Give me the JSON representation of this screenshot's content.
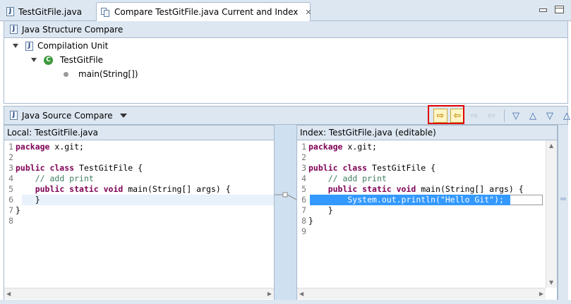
{
  "tabs": [
    {
      "label": "TestGitFile.java",
      "icon": "java-file-icon",
      "active": false
    },
    {
      "label": "Compare TestGitFile.java Current and Index",
      "icon": "compare-icon",
      "active": true,
      "close": "✕"
    }
  ],
  "structure": {
    "title": "Java Structure Compare",
    "tree": [
      {
        "label": "Compilation Unit",
        "icon": "java-file-icon",
        "expanded": true
      },
      {
        "label": "TestGitFile",
        "icon": "class-icon",
        "expanded": true
      },
      {
        "label": "main(String[])",
        "icon": "method-icon"
      }
    ]
  },
  "source_compare": {
    "title": "Java Source Compare",
    "toolbar": [
      {
        "icon": "copy-left-to-right-icon",
        "glyph": "⇨"
      },
      {
        "icon": "copy-current-change-left-to-right-icon",
        "glyph": "⇦"
      },
      {
        "icon": "copy-right-to-left-icon",
        "glyph": "⇨"
      },
      {
        "icon": "copy-current-change-right-to-left-icon",
        "glyph": "⇦"
      },
      {
        "icon": "next-difference-icon",
        "glyph": "▽"
      },
      {
        "icon": "previous-difference-icon",
        "glyph": "△"
      },
      {
        "icon": "next-change-icon",
        "glyph": "▽"
      },
      {
        "icon": "previous-change-icon",
        "glyph": "△"
      }
    ]
  },
  "left_editor": {
    "title": "Local: TestGitFile.java",
    "lines": [
      {
        "n": "1",
        "text": "package x.git;"
      },
      {
        "n": "2",
        "text": ""
      },
      {
        "n": "3",
        "text": "public class TestGitFile {"
      },
      {
        "n": "4",
        "text": "    // add print"
      },
      {
        "n": "5",
        "text": "    public static void main(String[] args) {"
      },
      {
        "n": "6",
        "text": "    }"
      },
      {
        "n": "7",
        "text": "}"
      },
      {
        "n": "8",
        "text": ""
      }
    ]
  },
  "right_editor": {
    "title": "Index: TestGitFile.java (editable)",
    "lines": [
      {
        "n": "1",
        "text": "package x.git;"
      },
      {
        "n": "2",
        "text": ""
      },
      {
        "n": "3",
        "text": "public class TestGitFile {"
      },
      {
        "n": "4",
        "text": "    // add print"
      },
      {
        "n": "5",
        "text": "    public static void main(String[] args) {"
      },
      {
        "n": "6",
        "text": "        System.out.println(\"Hello Git\");"
      },
      {
        "n": "7",
        "text": "    }"
      },
      {
        "n": "8",
        "text": "}"
      },
      {
        "n": "9",
        "text": ""
      }
    ]
  },
  "colors": {
    "chrome": "#dde7f1",
    "border": "#a7bacd",
    "keyword": "#7f0055",
    "comment": "#3f7f5f",
    "string": "#2a00ff",
    "selection": "#3399ff",
    "highlight_box": "#e00000"
  }
}
